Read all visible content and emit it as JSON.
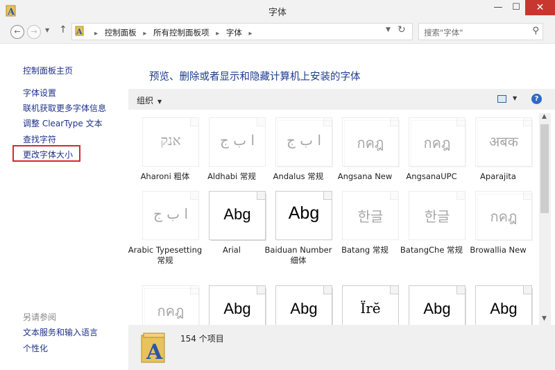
{
  "window": {
    "title": "字体",
    "minimize": "—",
    "maximize": "☐",
    "close": "✕"
  },
  "address": {
    "crumbs": [
      "控制面板",
      "所有控制面板项",
      "字体"
    ],
    "search_placeholder": "搜索\"字体\"",
    "icons": {
      "back": "arrow-left-icon",
      "forward": "arrow-right-icon",
      "recent": "chevron-down-icon",
      "up": "arrow-up-icon",
      "refresh": "refresh-icon",
      "search": "search-icon"
    }
  },
  "left_pane": {
    "home": "控制面板主页",
    "links": [
      "字体设置",
      "联机获取更多字体信息",
      "调整 ClearType 文本",
      "查找字符",
      "更改字体大小"
    ],
    "see_also_title": "另请参阅",
    "see_also": [
      "文本服务和输入语言",
      "个性化"
    ],
    "highlight_color": "#d9262e"
  },
  "content": {
    "title": "预览、删除或者显示和隐藏计算机上安装的字体",
    "organize": "组织",
    "fonts": [
      {
        "name": "Aharoni 粗体",
        "sample": "אנק",
        "faded": true,
        "stack": false
      },
      {
        "name": "Aldhabi 常规",
        "sample": "ا ب ج",
        "faded": true,
        "stack": false
      },
      {
        "name": "Andalus 常规",
        "sample": "ا ب ج",
        "faded": true,
        "stack": true
      },
      {
        "name": "Angsana New",
        "sample": "กคฎ",
        "faded": true,
        "stack": true
      },
      {
        "name": "AngsanaUPC",
        "sample": "กคฎ",
        "faded": true,
        "stack": true
      },
      {
        "name": "Aparajita",
        "sample": "अबक",
        "faded": true,
        "stack": true
      },
      {
        "name": "Arabic Typesetting 常规",
        "sample": "ا ب ج",
        "faded": true,
        "stack": false
      },
      {
        "name": "Arial",
        "sample": "Abg",
        "faded": false,
        "stack": true
      },
      {
        "name": "Baiduan Number 细体",
        "sample": "Abg",
        "faded": false,
        "stack": false
      },
      {
        "name": "Batang 常规",
        "sample": "한글",
        "faded": true,
        "stack": false
      },
      {
        "name": "BatangChe 常规",
        "sample": "한글",
        "faded": true,
        "stack": false
      },
      {
        "name": "Browallia New",
        "sample": "กคฎ",
        "faded": true,
        "stack": true
      },
      {
        "name": "",
        "sample": "กคฎ",
        "faded": true,
        "stack": true
      },
      {
        "name": "",
        "sample": "Abg",
        "faded": false,
        "stack": true
      },
      {
        "name": "",
        "sample": "Abg",
        "faded": false,
        "stack": true
      },
      {
        "name": "",
        "sample": "Ïrĕ",
        "faded": false,
        "stack": false
      },
      {
        "name": "",
        "sample": "Abg",
        "faded": false,
        "stack": true
      },
      {
        "name": "",
        "sample": "Abg",
        "faded": false,
        "stack": true
      }
    ]
  },
  "status": {
    "count": "154 个项目"
  },
  "colors": {
    "link": "#1e3287",
    "title": "#1e3c8c",
    "close": "#c7372f",
    "accent": "#2c6ac7"
  }
}
